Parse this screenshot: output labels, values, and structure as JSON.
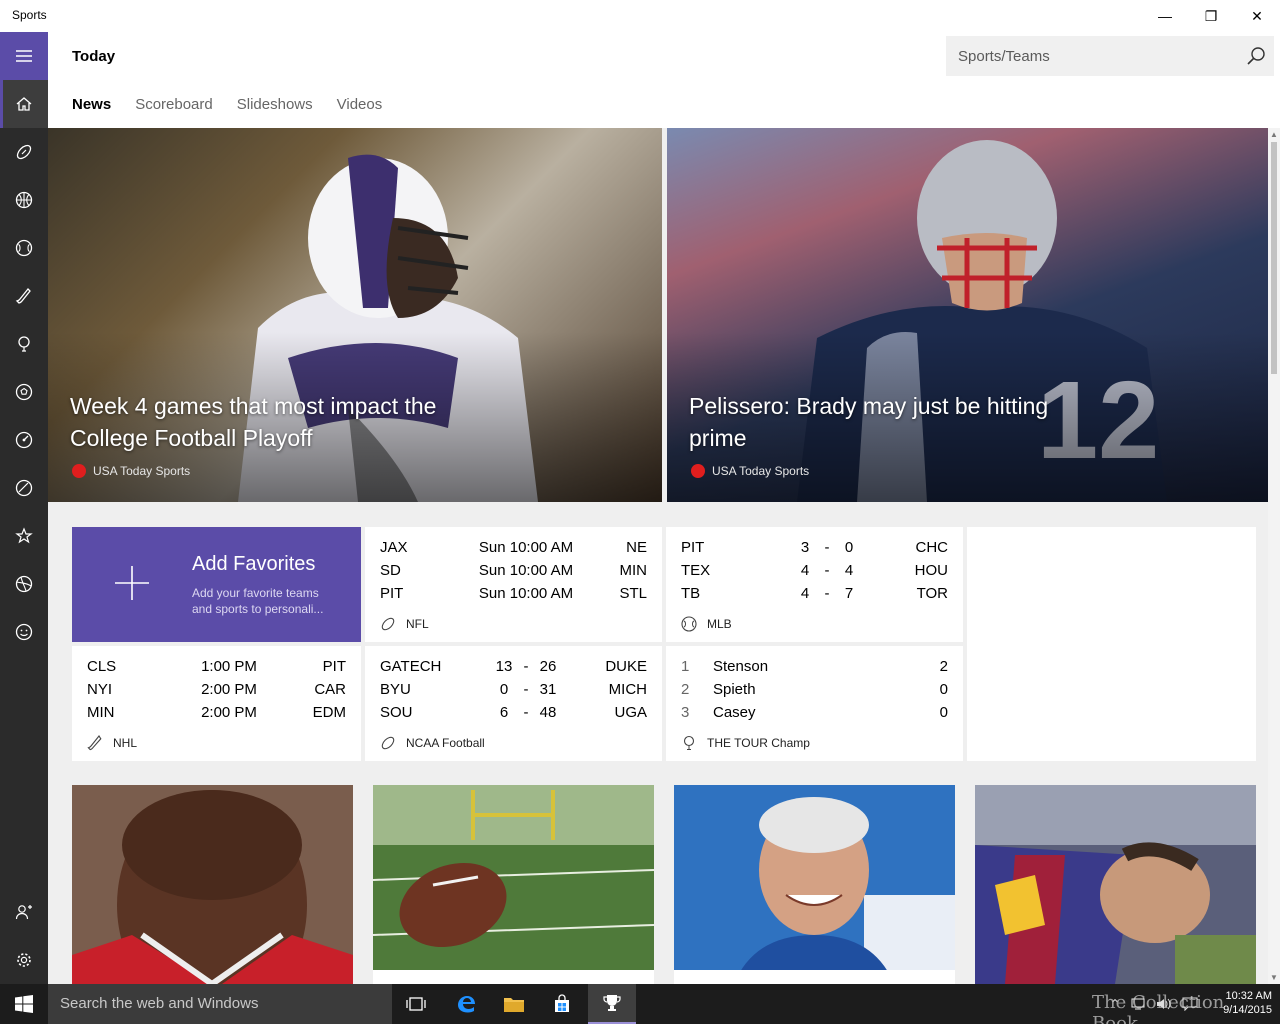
{
  "window": {
    "title": "Sports",
    "minimize_glyph": "—",
    "maximize_glyph": "❐",
    "close_glyph": "✕"
  },
  "nav": {
    "items": [
      {
        "icon": "home-icon",
        "active": true
      },
      {
        "icon": "football-icon"
      },
      {
        "icon": "basketball-icon"
      },
      {
        "icon": "baseball-icon"
      },
      {
        "icon": "hockey-icon"
      },
      {
        "icon": "golf-icon"
      },
      {
        "icon": "soccer-icon"
      },
      {
        "icon": "racing-icon"
      },
      {
        "icon": "ncaa-football-icon"
      },
      {
        "icon": "favorites-star-icon"
      },
      {
        "icon": "ncaa-basketball-icon"
      },
      {
        "icon": "fun-icon"
      }
    ],
    "bottom": [
      {
        "icon": "add-person-icon"
      },
      {
        "icon": "settings-icon"
      }
    ]
  },
  "header": {
    "title": "Today",
    "search_placeholder": "Sports/Teams",
    "tabs": [
      "News",
      "Scoreboard",
      "Slideshows",
      "Videos"
    ],
    "active_tab": "News"
  },
  "hero": [
    {
      "headline": "Week 4 games that most impact the College Football Playoff",
      "source": "USA Today Sports"
    },
    {
      "headline": "Pelissero: Brady may just be hitting prime",
      "source": "USA Today Sports"
    }
  ],
  "favorites": {
    "title": "Add Favorites",
    "description": "Add your favorite teams and sports to personali..."
  },
  "scores": {
    "nfl": {
      "league": "NFL",
      "rows": [
        {
          "home": "JAX",
          "time": "Sun 10:00 AM",
          "away": "NE"
        },
        {
          "home": "SD",
          "time": "Sun 10:00 AM",
          "away": "MIN"
        },
        {
          "home": "PIT",
          "time": "Sun 10:00 AM",
          "away": "STL"
        }
      ]
    },
    "mlb": {
      "league": "MLB",
      "rows": [
        {
          "home": "PIT",
          "s1": "3",
          "dash": "-",
          "s2": "0",
          "away": "CHC"
        },
        {
          "home": "TEX",
          "s1": "4",
          "dash": "-",
          "s2": "4",
          "away": "HOU"
        },
        {
          "home": "TB",
          "s1": "4",
          "dash": "-",
          "s2": "7",
          "away": "TOR"
        }
      ]
    },
    "nhl": {
      "league": "NHL",
      "rows": [
        {
          "home": "CLS",
          "time": "1:00 PM",
          "away": "PIT"
        },
        {
          "home": "NYI",
          "time": "2:00 PM",
          "away": "CAR"
        },
        {
          "home": "MIN",
          "time": "2:00 PM",
          "away": "EDM"
        }
      ]
    },
    "ncaa": {
      "league": "NCAA Football",
      "rows": [
        {
          "home": "GATECH",
          "s1": "13",
          "dash": "-",
          "s2": "26",
          "away": "DUKE"
        },
        {
          "home": "BYU",
          "s1": "0",
          "dash": "-",
          "s2": "31",
          "away": "MICH"
        },
        {
          "home": "SOU",
          "s1": "6",
          "dash": "-",
          "s2": "48",
          "away": "UGA"
        }
      ]
    },
    "golf": {
      "league": "THE TOUR Champ",
      "rows": [
        {
          "rank": "1",
          "name": "Stenson",
          "score": "2"
        },
        {
          "rank": "2",
          "name": "Spieth",
          "score": "0"
        },
        {
          "rank": "3",
          "name": "Casey",
          "score": "0"
        }
      ]
    }
  },
  "image_tiles": [
    {
      "subject": "basketball-player-photo"
    },
    {
      "subject": "football-on-field-photo"
    },
    {
      "subject": "coach-portrait-photo"
    },
    {
      "subject": "soccer-player-photo"
    }
  ],
  "taskbar": {
    "search_placeholder": "Search the web and Windows",
    "watermark": "The Collection Book",
    "time": "10:32 AM",
    "date": "9/14/2015"
  },
  "colors": {
    "accent": "#5b4ca8",
    "rail": "#2b2b2b",
    "taskbar": "#1c1c1c",
    "source_dot": "#e01e1e"
  }
}
